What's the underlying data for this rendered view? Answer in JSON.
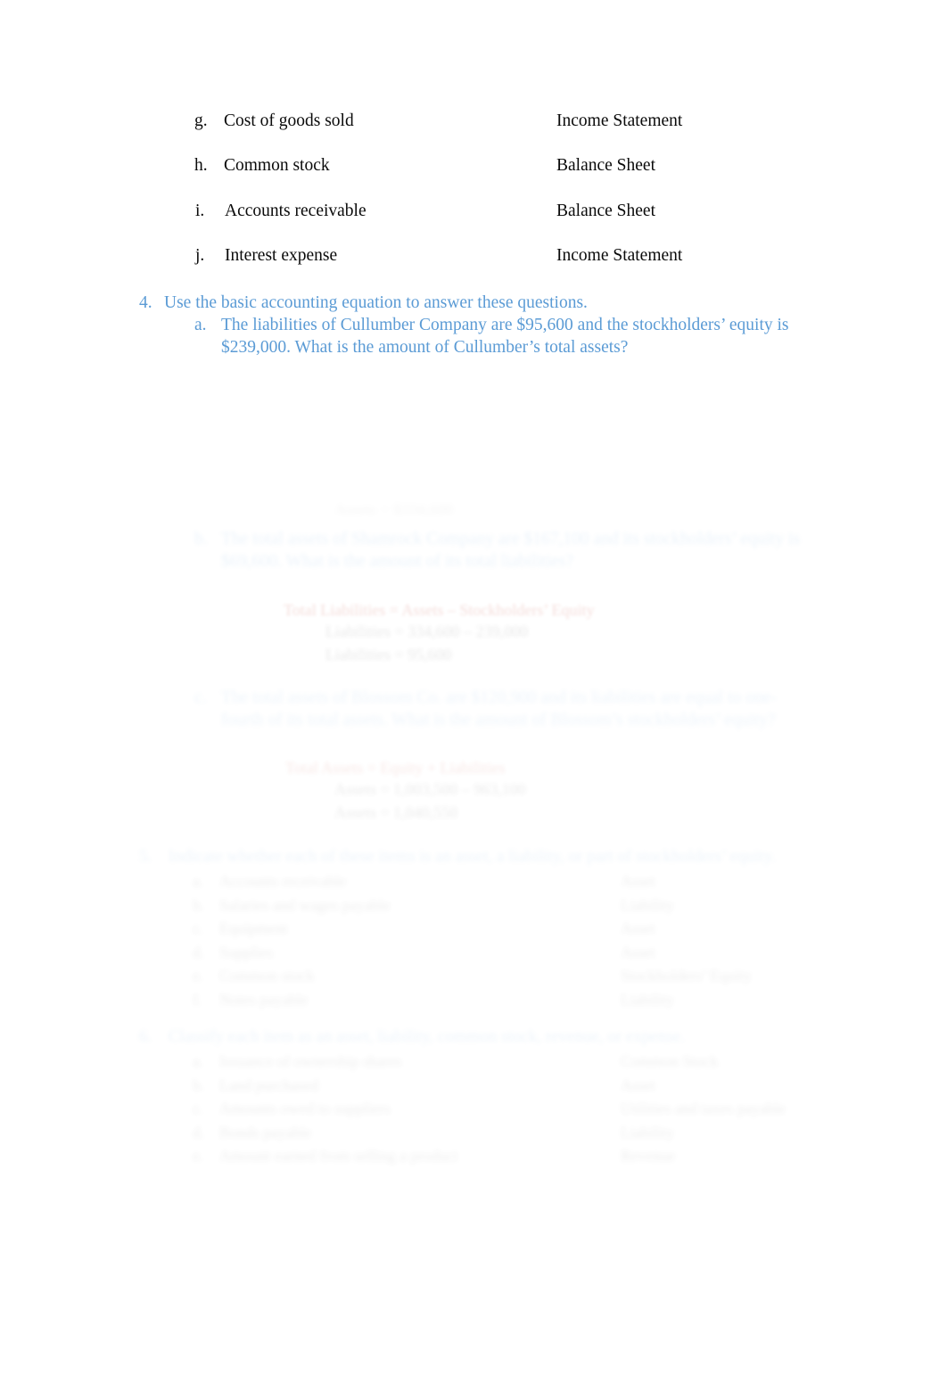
{
  "document": {
    "page_background": "#ffffff",
    "body_text_color": "#0a0a0a",
    "accent_blue": "#5b9bd5",
    "accent_red": "#c0392b"
  },
  "classification_list": {
    "items": [
      {
        "marker": "g.",
        "label": "Cost of goods sold",
        "answer": "Income Statement"
      },
      {
        "marker": "h.",
        "label": "Common stock",
        "answer": "Balance Sheet"
      },
      {
        "marker": "i.",
        "label": "Accounts receivable",
        "answer": "Balance Sheet"
      },
      {
        "marker": "j.",
        "label": "Interest expense",
        "answer": "Income Statement"
      }
    ]
  },
  "question_4": {
    "marker": "4.",
    "text": "Use the basic accounting equation to answer these questions.",
    "sub_a": {
      "marker": "a.",
      "line1": "The liabilities of Cullumber Company are $95,600 and the stockholders’ equity is",
      "line2": "$239,000. What is the amount of Cullumber’s total assets?"
    },
    "answer_a_ghost": "Assets = $334,600",
    "sub_b": {
      "marker": "b.",
      "line1": "The total assets of Shamrock Company are $167,100 and its stockholders’ equity is",
      "line2": "$69,600. What is the amount of its total liabilities?"
    },
    "formula_b": {
      "equation": "Total Liabilities = Assets – Stockholders’ Equity",
      "step1": "Liabilities = 334,600 – 239,000",
      "step2": "Liabilities = 95,600"
    },
    "sub_c": {
      "marker": "c.",
      "line1": "The total assets of Blossom Co. are $120,900 and its liabilities are equal to one-fourth of",
      "line2": "its total assets. What is the amount of Blossom’s stockholders’ equity?"
    },
    "formula_c": {
      "equation": "Total Assets = Equity + Liabilities",
      "step1": "Assets = 1,003,500 – 963,100",
      "step2": "Assets = 1,040,550"
    }
  },
  "question_5": {
    "marker": "5.",
    "text": "Indicate whether each of these items is an asset, a liability, or part of stockholders’ equity.",
    "items": [
      {
        "marker": "a.",
        "label": "Accounts receivable",
        "answer": "Asset"
      },
      {
        "marker": "b.",
        "label": "Salaries and wages payable",
        "answer": "Liability"
      },
      {
        "marker": "c.",
        "label": "Equipment",
        "answer": "Asset"
      },
      {
        "marker": "d.",
        "label": "Supplies",
        "answer": "Asset"
      },
      {
        "marker": "e.",
        "label": "Common stock",
        "answer": "Stockholders’ Equity"
      },
      {
        "marker": "f.",
        "label": "Notes payable",
        "answer": "Liability"
      }
    ]
  },
  "question_6": {
    "marker": "6.",
    "text": "Classify each item as an asset, liability, common stock, revenue, or expense.",
    "items": [
      {
        "marker": "a.",
        "label": "Issuance of ownership shares",
        "answer": "Common Stock"
      },
      {
        "marker": "b.",
        "label": "Land purchased",
        "answer": "Asset"
      },
      {
        "marker": "c.",
        "label": "Amounts owed to suppliers",
        "answer": "Utilities and taxes payable"
      },
      {
        "marker": "d.",
        "label": "Bonds payable",
        "answer": "Liability"
      },
      {
        "marker": "e.",
        "label": "Amount earned from selling a product",
        "answer": "Revenue"
      }
    ]
  }
}
